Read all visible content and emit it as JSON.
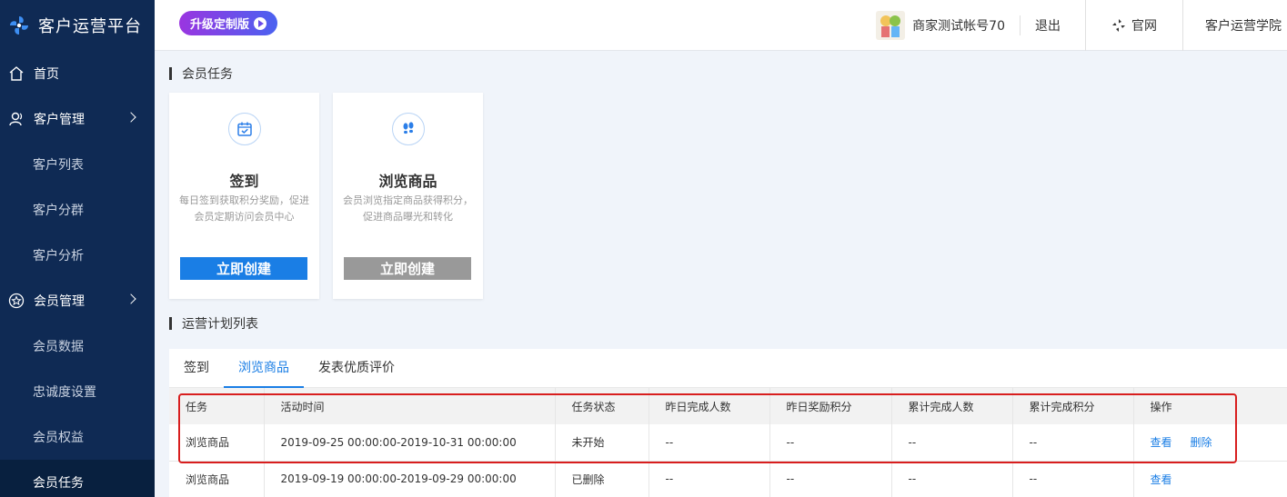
{
  "app": {
    "title": "客户运营平台",
    "upgrade_label": "升级定制版"
  },
  "header": {
    "account": "商家测试帐号70",
    "logout": "退出",
    "official_site": "官网",
    "academy": "客户运营学院"
  },
  "sidebar": {
    "items": [
      {
        "label": "首页",
        "icon": "home-icon"
      },
      {
        "label": "客户管理",
        "icon": "users-icon"
      },
      {
        "label": "客户列表"
      },
      {
        "label": "客户分群"
      },
      {
        "label": "客户分析"
      },
      {
        "label": "会员管理",
        "icon": "star-icon"
      },
      {
        "label": "会员数据"
      },
      {
        "label": "忠诚度设置"
      },
      {
        "label": "会员权益"
      },
      {
        "label": "会员任务"
      }
    ]
  },
  "sections": {
    "tasks_title": "会员任务",
    "plans_title": "运营计划列表"
  },
  "cards": [
    {
      "title": "签到",
      "desc": "每日签到获取积分奖励，促进会员定期访问会员中心",
      "button": "立即创建",
      "icon": "calendar-check-icon"
    },
    {
      "title": "浏览商品",
      "desc": "会员浏览指定商品获得积分，促进商品曝光和转化",
      "button": "立即创建",
      "icon": "footprints-icon"
    }
  ],
  "tabs": [
    "签到",
    "浏览商品",
    "发表优质评价"
  ],
  "table": {
    "columns": [
      "任务",
      "活动时间",
      "任务状态",
      "昨日完成人数",
      "昨日奖励积分",
      "累计完成人数",
      "累计完成积分",
      "操作"
    ],
    "rows": [
      {
        "task": "浏览商品",
        "time": "2019-09-25 00:00:00-2019-10-31 00:00:00",
        "status": "未开始",
        "y_users": "--",
        "y_points": "--",
        "t_users": "--",
        "t_points": "--",
        "view": "查看",
        "delete": "删除"
      },
      {
        "task": "浏览商品",
        "time": "2019-09-19 00:00:00-2019-09-29 00:00:00",
        "status": "已删除",
        "y_users": "--",
        "y_points": "--",
        "t_users": "--",
        "t_points": "--",
        "view": "查看"
      }
    ]
  },
  "colors": {
    "sidebar_bg": "#0f2a54",
    "accent": "#1a7ee5",
    "highlight": "#d81e1e"
  }
}
